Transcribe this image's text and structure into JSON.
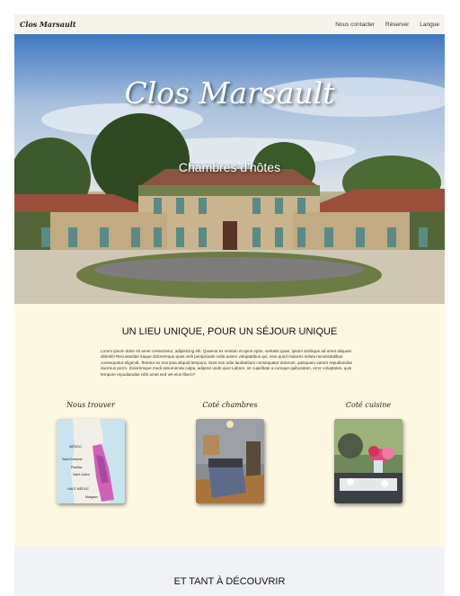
{
  "nav": {
    "brand": "Clos Marsault",
    "links": [
      "Nous contacter",
      "Réserver",
      "Langue"
    ]
  },
  "hero": {
    "title": "Clos Marsault",
    "subtitle": "Chambres d'hôtes"
  },
  "intro": {
    "title": "UN LIEU UNIQUE, POUR UN SÉJOUR UNIQUE",
    "text": "Lorem ipsum dolor sit amet consectetur, adipisicing elit. Quaerat ex veniam et quos optio, veritatis quae, ipsum similique ad amet aliquam deleniti! Recusandae itaque doloremque quos velit perspiciatis nulla autem voluptatibus qui, eius quod maiores soluta necessitatibus consequatur eligendi. Tenetur ex eos ipsa aliquid tempora. Sunt non odio laudantium consequatur dolorum, quisquam earum repudiandae ducimus porro. Doloremque modi assumenda culpa, adipisci unde quo! Labore, sit cupiditate a cumque quibusdam, error voluptates, quis tempore repudiandae nihil amet sed vel eius libero?"
  },
  "columns": [
    {
      "label": "Nous trouver",
      "image": "map-medoc"
    },
    {
      "label": "Coté chambres",
      "image": "bedroom-photo"
    },
    {
      "label": "Coté cuisine",
      "image": "kitchen-photo"
    }
  ],
  "map_labels": [
    "MÉDOC",
    "Saint-Estèphe",
    "Pauillac",
    "Saint-Julien",
    "HAUT-MÉDOC",
    "Margaux"
  ],
  "more": {
    "title": "ET TANT À DÉCOUVRIR"
  },
  "colors": {
    "nav_bg": "#f6f3ea",
    "cream_bg": "#fdf8e2",
    "bottom_bg": "#f1f2f6"
  }
}
